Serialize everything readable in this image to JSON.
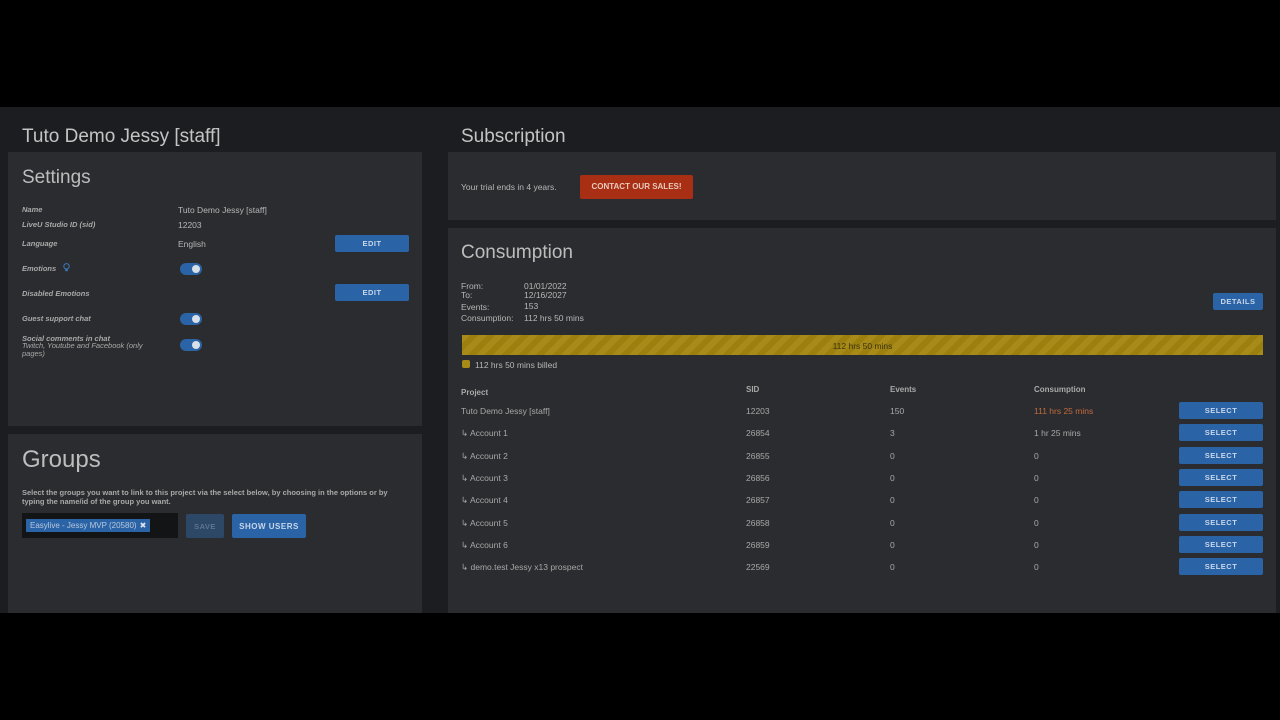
{
  "left_title": "Tuto Demo Jessy [staff]",
  "right_title": "Subscription",
  "settings": {
    "title": "Settings",
    "rows": [
      {
        "label": "Name",
        "value": "Tuto Demo Jessy [staff]"
      },
      {
        "label": "LiveU Studio ID (sid)",
        "value": "12203"
      },
      {
        "label": "Language",
        "value": "English",
        "button": "EDIT"
      },
      {
        "label": "Emotions",
        "toggle": true
      },
      {
        "label": "Disabled Emotions",
        "button": "EDIT"
      },
      {
        "label": "Guest support chat",
        "toggle": true
      },
      {
        "label": "Social comments in chat",
        "sublabel": "Twitch, Youtube and Facebook (only pages)",
        "toggle": true
      }
    ]
  },
  "groups": {
    "title": "Groups",
    "description": "Select the groups you want to link to this project via the select below, by choosing in the options or by typing the name/id of the group you want.",
    "selected_tag": "Easylive - Jessy MVP (20580)",
    "tag_remove": "✖",
    "save_label": "SAVE",
    "show_users_label": "SHOW USERS"
  },
  "subscription": {
    "trial_text": "Your trial ends in 4 years.",
    "contact_label": "CONTACT OUR SALES!"
  },
  "consumption": {
    "title": "Consumption",
    "summary": [
      {
        "label": "From:",
        "value": "01/01/2022"
      },
      {
        "label": "To:",
        "value": "12/16/2027"
      },
      {
        "label": "Events:",
        "value": "153"
      },
      {
        "label": "Consumption:",
        "value": "112 hrs 50 mins"
      }
    ],
    "details_label": "DETAILS",
    "bar_text": "112 hrs 50 mins",
    "bar_fraction": 1.0,
    "legend_text": "112 hrs 50 mins billed",
    "columns": [
      "Project",
      "SID",
      "Events",
      "Consumption"
    ],
    "rows": [
      {
        "project": "Tuto Demo Jessy [staff]",
        "sid": "12203",
        "events": "150",
        "consumption": "111 hrs 25 mins",
        "highlight": true,
        "action": "SELECT"
      },
      {
        "project": "↳ Account 1",
        "sid": "26854",
        "events": "3",
        "consumption": "1 hr 25 mins",
        "highlight": false,
        "action": "SELECT"
      },
      {
        "project": "↳ Account 2",
        "sid": "26855",
        "events": "0",
        "consumption": "0",
        "highlight": false,
        "action": "SELECT"
      },
      {
        "project": "↳ Account 3",
        "sid": "26856",
        "events": "0",
        "consumption": "0",
        "highlight": false,
        "action": "SELECT"
      },
      {
        "project": "↳ Account 4",
        "sid": "26857",
        "events": "0",
        "consumption": "0",
        "highlight": false,
        "action": "SELECT"
      },
      {
        "project": "↳ Account 5",
        "sid": "26858",
        "events": "0",
        "consumption": "0",
        "highlight": false,
        "action": "SELECT"
      },
      {
        "project": "↳ Account 6",
        "sid": "26859",
        "events": "0",
        "consumption": "0",
        "highlight": false,
        "action": "SELECT"
      },
      {
        "project": "↳ demo.test Jessy x13 prospect",
        "sid": "22569",
        "events": "0",
        "consumption": "0",
        "highlight": false,
        "action": "SELECT"
      }
    ]
  },
  "colors": {
    "accent": "#2a63a6",
    "danger": "#a82f14",
    "progress": "#a88a18",
    "panel": "#2b2c2f",
    "background": "#1b1d20"
  },
  "icons": {
    "emotions_hint": "lightbulb-icon",
    "tag_remove": "close-icon"
  }
}
